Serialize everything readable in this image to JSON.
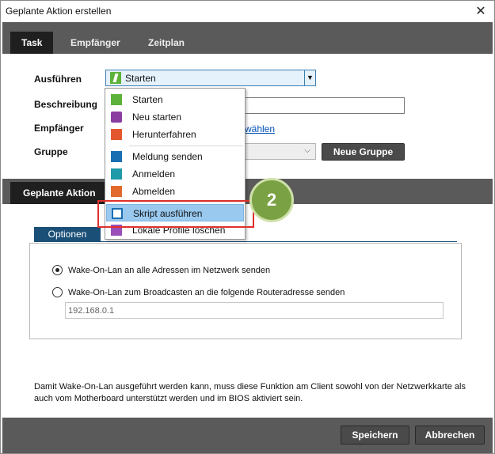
{
  "window": {
    "title": "Geplante Aktion erstellen",
    "close_glyph": "✕"
  },
  "tabs": [
    {
      "label": "Task"
    },
    {
      "label": "Empfänger"
    },
    {
      "label": "Zeitplan"
    }
  ],
  "form": {
    "ausfuehren_label": "Ausführen",
    "ausfuehren_value": "Starten",
    "beschreibung_label": "Beschreibung",
    "beschreibung_value": "",
    "empfaenger_label": "Empfänger",
    "empfaenger_link": "wählen",
    "gruppe_label": "Gruppe",
    "gruppe_value": "",
    "neue_gruppe_button": "Neue Gruppe"
  },
  "dropdown_menu": {
    "items": [
      {
        "label": "Starten",
        "icon": "power-bolt-icon",
        "color": "#5cb23a"
      },
      {
        "label": "Neu starten",
        "icon": "restart-icon",
        "color": "#8a3ea0"
      },
      {
        "label": "Herunterfahren",
        "icon": "shutdown-icon",
        "color": "#e4572e"
      },
      {
        "label": "Meldung senden",
        "icon": "message-icon",
        "color": "#1a6fb3"
      },
      {
        "label": "Anmelden",
        "icon": "login-icon",
        "color": "#1f9aa8"
      },
      {
        "label": "Abmelden",
        "icon": "logout-icon",
        "color": "#e26a2c"
      },
      {
        "label": "Skript ausführen",
        "icon": "script-icon",
        "color": "#1a6fb3"
      },
      {
        "label": "Lokale Profile löschen",
        "icon": "delete-profile-icon",
        "color": "#9a4fb8"
      }
    ],
    "hovered_index": 6
  },
  "callout_badge": "2",
  "scheduled_action": {
    "tab_label": "Geplante Aktion",
    "options_tab": "Optionen",
    "radio1_label": "Wake-On-Lan an alle Adressen im Netzwerk senden",
    "radio1_checked": true,
    "radio2_label": "Wake-On-Lan zum Broadcasten an die folgende Routeradresse senden",
    "radio2_checked": false,
    "router_address_placeholder": "192.168.0.1",
    "note": "Damit Wake-On-Lan ausgeführt werden kann, muss diese Funktion am Client sowohl von der Netzwerkkarte als auch vom Motherboard unterstützt werden und im BIOS aktiviert sein."
  },
  "footer": {
    "save_button": "Speichern",
    "cancel_button": "Abbrechen"
  },
  "colors": {
    "dark_bar": "#5a5a5a",
    "active_tab": "#1f1f1f",
    "options_tab": "#1a4f77",
    "highlight_red": "#e0302b",
    "badge_green": "#7aa244",
    "menu_hover": "#99c9ef"
  }
}
